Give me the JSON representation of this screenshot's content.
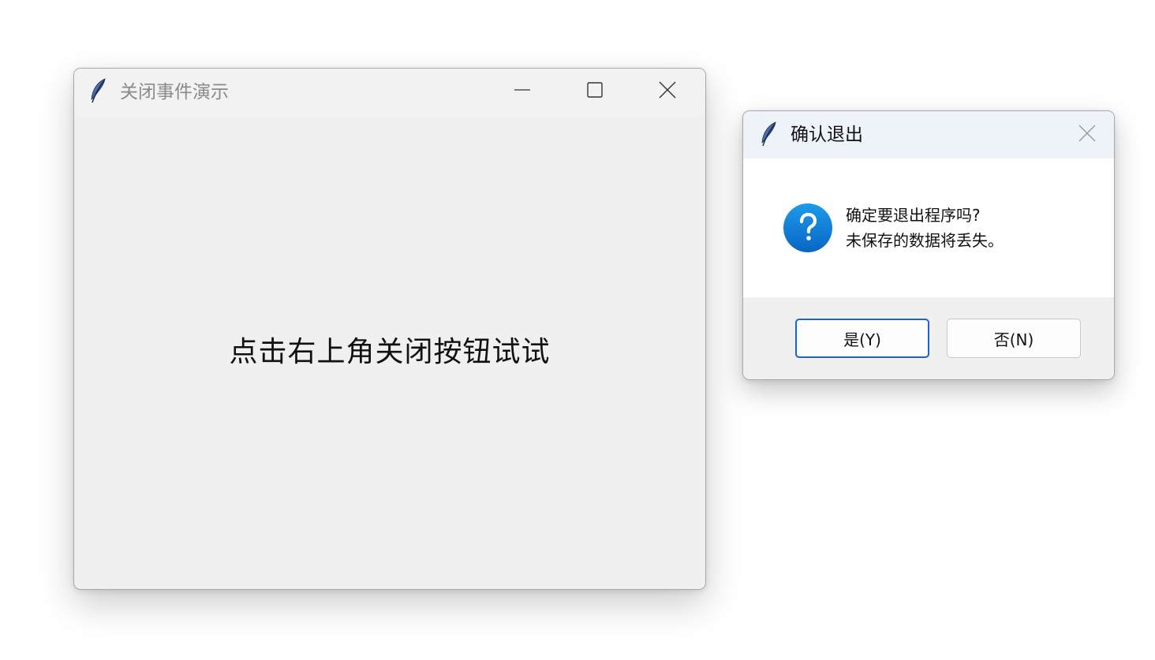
{
  "main_window": {
    "title": "关闭事件演示",
    "label": "点击右上角关闭按钮试试",
    "icons": {
      "app": "feather-icon",
      "minimize": "minimize-icon",
      "maximize": "maximize-icon",
      "close": "close-icon"
    }
  },
  "dialog": {
    "title": "确认退出",
    "message_lines": [
      "确定要退出程序吗?",
      "未保存的数据将丢失。"
    ],
    "icon": "question-icon",
    "buttons": {
      "yes": "是(Y)",
      "no": "否(N)"
    }
  },
  "colors": {
    "accent": "#1f63c4",
    "window_bg": "#f0f0f0",
    "dialog_titlebar": "#eef3fa"
  }
}
